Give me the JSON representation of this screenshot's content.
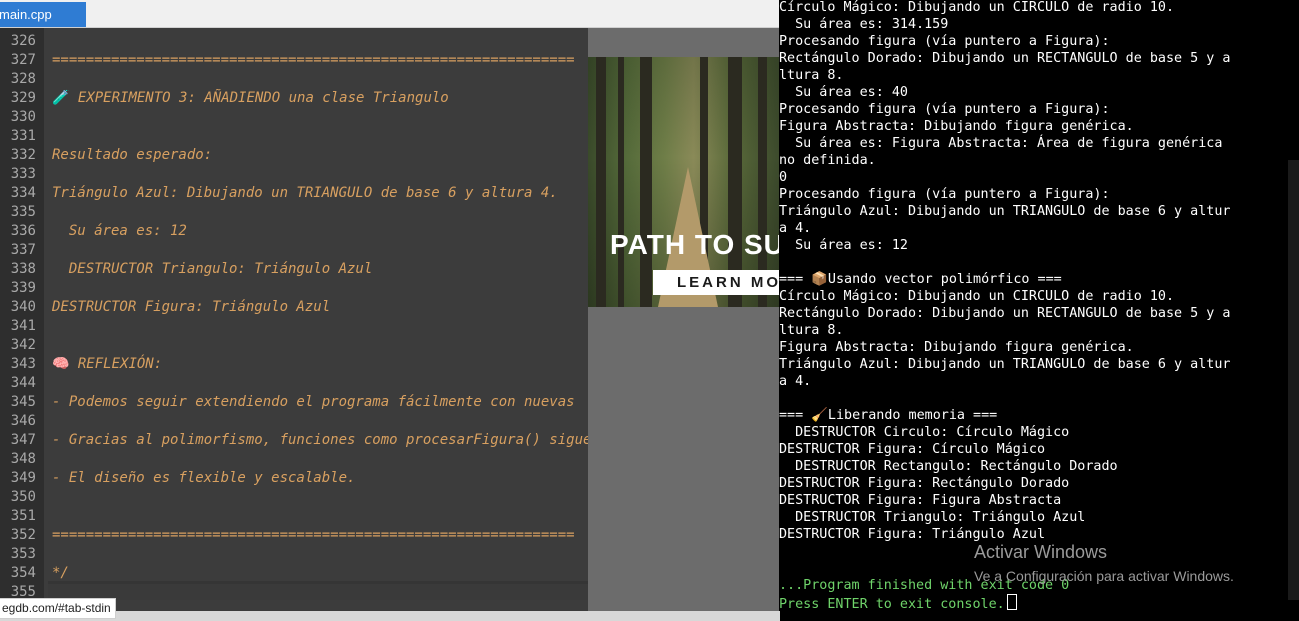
{
  "tab": {
    "label": "main.cpp"
  },
  "editor": {
    "line_numbers": [
      "326",
      "327",
      "328",
      "329",
      "330",
      "331",
      "332",
      "333",
      "334",
      "335",
      "336",
      "337",
      "338",
      "339",
      "340",
      "341",
      "342",
      "343",
      "344",
      "345",
      "346",
      "347",
      "348",
      "349",
      "350",
      "351",
      "352",
      "353",
      "354",
      "355"
    ],
    "lines": [
      {
        "text": ""
      },
      {
        "text": "=============================================================="
      },
      {
        "text": ""
      },
      {
        "emoji": "🧪",
        "text": " EXPERIMENTO 3: AÑADIENDO una clase Triangulo"
      },
      {
        "text": ""
      },
      {
        "text": ""
      },
      {
        "text": "Resultado esperado:"
      },
      {
        "text": ""
      },
      {
        "text": "Triángulo Azul: Dibujando un TRIANGULO de base 6 y altura 4."
      },
      {
        "text": ""
      },
      {
        "text": "  Su área es: 12"
      },
      {
        "text": ""
      },
      {
        "text": "  DESTRUCTOR Triangulo: Triángulo Azul"
      },
      {
        "text": ""
      },
      {
        "text": "DESTRUCTOR Figura: Triángulo Azul"
      },
      {
        "text": ""
      },
      {
        "text": ""
      },
      {
        "emoji": "🧠",
        "text": " REFLEXIÓN:"
      },
      {
        "text": ""
      },
      {
        "text": "- Podemos seguir extendiendo el programa fácilmente con nuevas"
      },
      {
        "text": ""
      },
      {
        "text": "- Gracias al polimorfismo, funciones como procesarFigura() siguen"
      },
      {
        "text": ""
      },
      {
        "text": "- El diseño es flexible y escalable."
      },
      {
        "text": ""
      },
      {
        "text": ""
      },
      {
        "text": "=============================================================="
      },
      {
        "text": ""
      },
      {
        "text": "*/"
      },
      {
        "text": ""
      }
    ]
  },
  "ad": {
    "headline": "PATH TO SUCCESS",
    "button_label": "LEARN MORE"
  },
  "console": {
    "lines": [
      {
        "text": "Círculo Mágico: Dibujando un CIRCULO de radio 10."
      },
      {
        "text": "  Su área es: 314.159"
      },
      {
        "text": "Procesando figura (vía puntero a Figura):"
      },
      {
        "text": "Rectángulo Dorado: Dibujando un RECTANGULO de base 5 y a"
      },
      {
        "text": "ltura 8."
      },
      {
        "text": "  Su área es: 40"
      },
      {
        "text": "Procesando figura (vía puntero a Figura):"
      },
      {
        "text": "Figura Abstracta: Dibujando figura genérica."
      },
      {
        "text": "  Su área es: Figura Abstracta: Área de figura genérica"
      },
      {
        "text": "no definida."
      },
      {
        "text": "0"
      },
      {
        "text": "Procesando figura (vía puntero a Figura):"
      },
      {
        "text": "Triángulo Azul: Dibujando un TRIANGULO de base 6 y altur"
      },
      {
        "text": "a 4."
      },
      {
        "text": "  Su área es: 12"
      },
      {
        "text": ""
      },
      {
        "text": "=== 📦Usando vector polimórfico ==="
      },
      {
        "text": "Círculo Mágico: Dibujando un CIRCULO de radio 10."
      },
      {
        "text": "Rectángulo Dorado: Dibujando un RECTANGULO de base 5 y a"
      },
      {
        "text": "ltura 8."
      },
      {
        "text": "Figura Abstracta: Dibujando figura genérica."
      },
      {
        "text": "Triángulo Azul: Dibujando un TRIANGULO de base 6 y altur"
      },
      {
        "text": "a 4."
      },
      {
        "text": ""
      },
      {
        "text": "=== 🧹Liberando memoria ==="
      },
      {
        "text": "  DESTRUCTOR Circulo: Círculo Mágico"
      },
      {
        "text": "DESTRUCTOR Figura: Círculo Mágico"
      },
      {
        "text": "  DESTRUCTOR Rectangulo: Rectángulo Dorado"
      },
      {
        "text": "DESTRUCTOR Figura: Rectángulo Dorado"
      },
      {
        "text": "DESTRUCTOR Figura: Figura Abstracta"
      },
      {
        "text": "  DESTRUCTOR Triangulo: Triángulo Azul"
      },
      {
        "text": "DESTRUCTOR Figura: Triángulo Azul"
      },
      {
        "text": ""
      },
      {
        "text": ""
      },
      {
        "text": "...Program finished with exit code 0",
        "green": true
      },
      {
        "text": "Press ENTER to exit console.",
        "green": true,
        "caret": true
      }
    ]
  },
  "watermark": {
    "title": "Activar Windows",
    "subtitle": "Ve a Configuración para activar Windows."
  },
  "status": {
    "url_tooltip": "egdb.com/#tab-stdin"
  }
}
